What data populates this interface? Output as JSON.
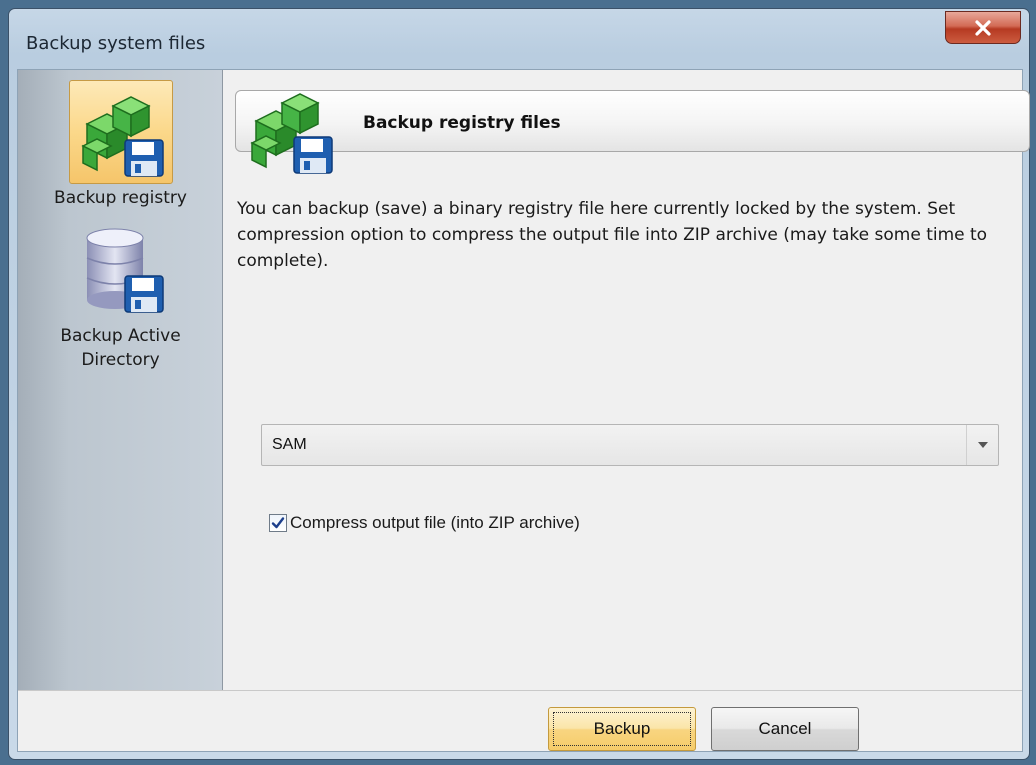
{
  "window": {
    "title": "Backup system files"
  },
  "sidebar": {
    "items": [
      {
        "label": "Backup registry",
        "icon": "registry-backup-icon",
        "active": true
      },
      {
        "label": "Backup Active Directory",
        "icon": "database-backup-icon",
        "active": false
      }
    ]
  },
  "main": {
    "header_title": "Backup registry files",
    "description": "You can backup (save) a binary registry file here currently locked by the system. Set compression option to compress the output file into ZIP archive (may take some time to complete).",
    "registry_select": {
      "value": "SAM"
    },
    "compress_checkbox": {
      "label": "Compress output file (into ZIP archive)",
      "checked": true
    }
  },
  "footer": {
    "backup_label": "Backup",
    "cancel_label": "Cancel"
  },
  "colors": {
    "active_item": "#fbd88a",
    "close_button": "#c8503a",
    "registry_green": "#3aa83a",
    "floppy_blue": "#1f5fb0"
  }
}
